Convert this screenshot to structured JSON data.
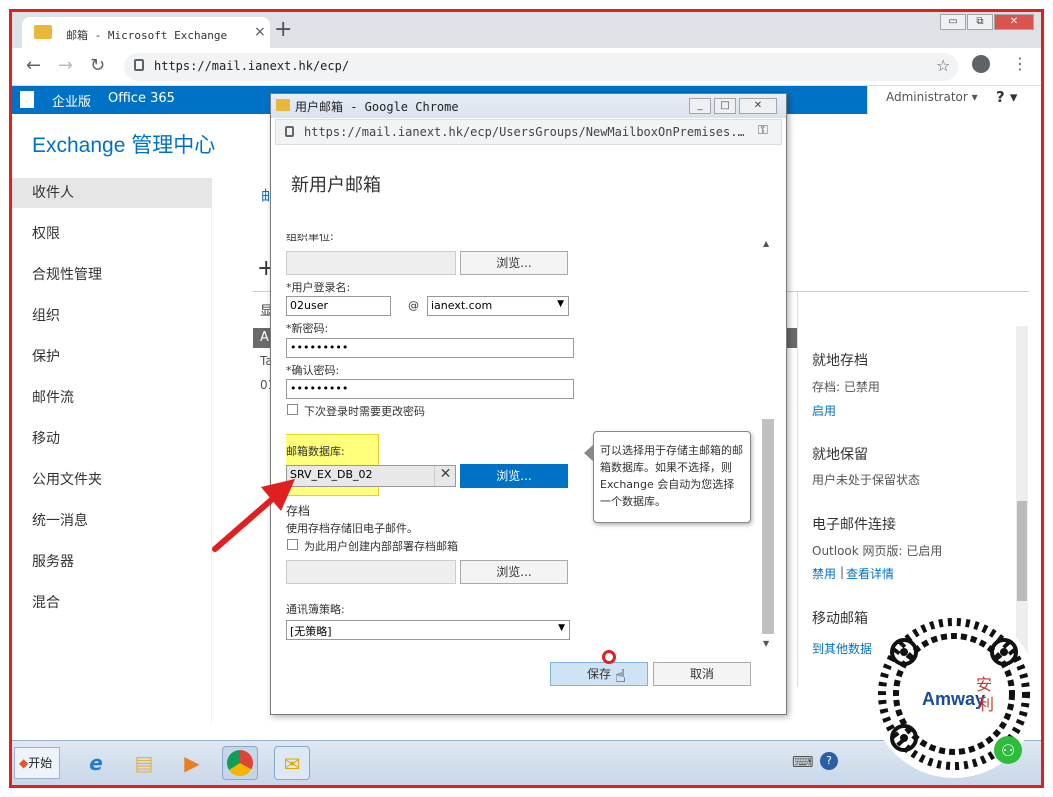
{
  "browser": {
    "tab_title": "邮箱 - Microsoft Exchange",
    "tab_close": "×",
    "new_tab": "+",
    "url": "https://mail.ianext.hk/ecp/",
    "win_controls": [
      "⧉",
      "▭",
      "✕"
    ],
    "icons": [
      "back-icon",
      "forward-icon",
      "reload-icon",
      "lock-icon",
      "star-icon",
      "account-icon",
      "menu-icon"
    ]
  },
  "ecp": {
    "edition": "企业版",
    "product": "Office 365",
    "admin": "Administrator ▾",
    "help": "? ▾",
    "title": "Exchange 管理中心",
    "nav": [
      "收件人",
      "权限",
      "合规性管理",
      "组织",
      "保护",
      "邮件流",
      "移动",
      "公用文件夹",
      "统一消息",
      "服务器",
      "混合"
    ],
    "partial": {
      "c1": "邮",
      "c2": "显",
      "c3": "A",
      "c4": "Ta",
      "c5": "01",
      "plus": "+"
    }
  },
  "detail": {
    "archive_title": "就地存档",
    "archive_status": "存档:   已禁用",
    "archive_enable": "启用",
    "hold_title": "就地保留",
    "hold_status": "用户未处于保留状态",
    "email_title": "电子邮件连接",
    "owa_status": "Outlook 网页版:  已启用",
    "disable_link": "禁用",
    "sep": "|",
    "details_link": "查看详情",
    "mobile_title": "移动邮箱",
    "other_link": "到其他数据"
  },
  "dialog": {
    "window_title": "用户邮箱 - Google Chrome",
    "url": "https://mail.ianext.hk/ecp/UsersGroups/NewMailboxOnPremises.…",
    "heading": "新用户邮箱",
    "org_unit_label": "组织单位:",
    "browse": "浏览...",
    "logon_label": "*用户登录名:",
    "logon_value": "02user",
    "at": "@",
    "domain": "ianext.com",
    "password_label": "*新密码:",
    "password_value": "•••••••••",
    "confirm_label": "*确认密码:",
    "confirm_value": "•••••••••",
    "change_pwd": "下次登录时需要更改密码",
    "db_label": "邮箱数据库:",
    "db_value": "SRV_EX_DB_02",
    "db_clear": "✕",
    "archive_label": "存档",
    "archive_desc": "使用存档存储旧电子邮件。",
    "archive_chk": "为此用户创建内部部署存档邮箱",
    "abp_label": "通讯簿策略:",
    "abp_value": "[无策略]",
    "save": "保存",
    "cancel": "取消",
    "tooltip": "可以选择用于存储主邮箱的邮箱数据库。如果不选择，则 Exchange 会自动为您选择一个数据库。"
  },
  "taskbar": {
    "start": "开始",
    "apps": [
      "ie-icon",
      "explorer-icon",
      "media-player-icon",
      "chrome-icon",
      "outlook-icon"
    ]
  },
  "qr": {
    "brand": "Amway",
    "mark": "安利"
  }
}
